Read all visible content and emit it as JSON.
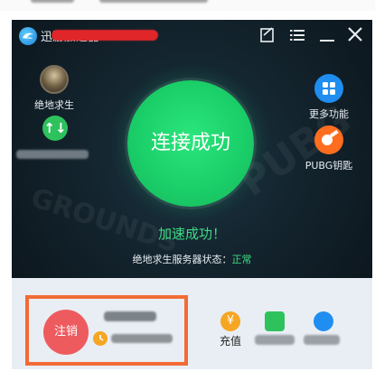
{
  "window": {
    "title": "迅游加速器"
  },
  "left_panel": {
    "game_label": "绝地求生",
    "accelerator_icon_glyph": "↑↓"
  },
  "main": {
    "connect_button_label": "连接成功",
    "status_title": "加速成功！",
    "server_status_label": "绝地求生服务器状态：",
    "server_status_value": "正常"
  },
  "right_panel": {
    "more_label": "更多功能",
    "pubg_key_label": "PUBG钥匙"
  },
  "bottom": {
    "logout_label": "注销",
    "recharge_label": "充值",
    "recharge_icon_glyph": "¥"
  },
  "colors": {
    "success_green": "#1bcf69",
    "highlight_orange": "#f26b35",
    "logout_red": "#ee5b5f",
    "accent_blue": "#1f8ef0"
  }
}
